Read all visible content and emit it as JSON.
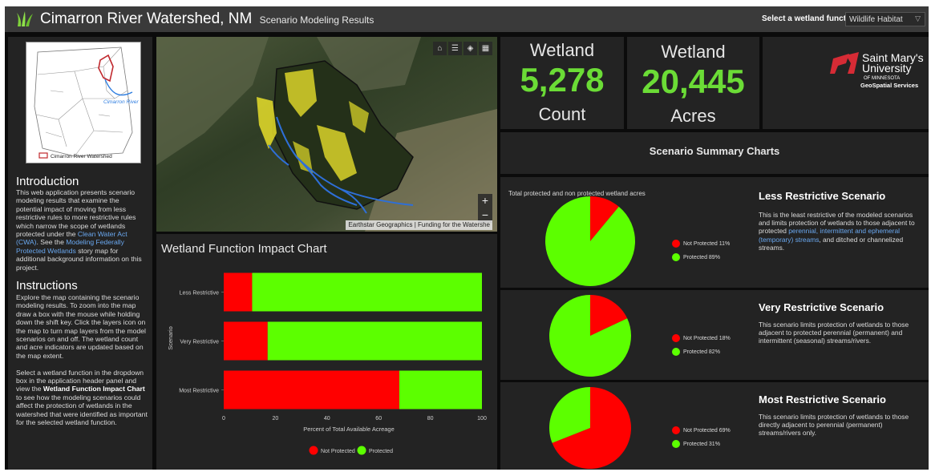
{
  "header": {
    "title": "Cimarron River Watershed, NM",
    "subtitle": "Scenario Modeling Results",
    "select_label": "Select a wetland function:",
    "select_value": "Wildlife Habitat",
    "logo_icon": "grass-icon"
  },
  "left": {
    "map_label_river": "Cimarron River",
    "map_legend": "Cimarron River Watershed",
    "intro_heading": "Introduction",
    "intro_text_1": "This web application presents scenario modeling results that examine the potential impact of moving from less restrictive rules to more restrictive rules which narrow the scope of wetlands protected under the ",
    "intro_link_1": "Clean Water Act (CWA)",
    "intro_text_2": ". See the ",
    "intro_link_2": "Modeling Federally Protected Wetlands",
    "intro_text_3": " story map for additional background information on this project.",
    "instr_heading": "Instructions",
    "instr_text_1": "Explore the map containing the scenario modeling results. To zoom into the map draw a box with the mouse while holding down the shift key. Click the layers icon on the map to turn map layers from the model scenarios on and off. The wetland count and acre indicators are updated based on the map extent.",
    "instr_text_2": "Select a wetland function in the dropdown box in the application header panel and view the ",
    "instr_bold": "Wetland Function Impact Chart",
    "instr_text_3": " to see how the modeling scenarios could affect the protection of wetlands in the watershed that were identified as important for the selected wetland function."
  },
  "map": {
    "attribution": "Earthstar Geographics | Funding for the Watershe",
    "tools": [
      "home-icon",
      "list-icon",
      "layers-icon",
      "grid-icon"
    ],
    "zoom_in": "+",
    "zoom_out": "−"
  },
  "indicators": {
    "count_label": "Wetland",
    "count_value": "5,278",
    "count_unit": "Count",
    "acres_label": "Wetland",
    "acres_value": "20,445",
    "acres_unit": "Acres"
  },
  "logo": {
    "line1": "Saint Mary's",
    "line2": "University",
    "line3": "OF MINNESOTA",
    "line4": "GeoSpatial Services"
  },
  "summary_title": "Scenario Summary Charts",
  "pie_chart_title": "Total protected and non protected wetland acres",
  "scenarios": [
    {
      "heading": "Less Restrictive Scenario",
      "text_1": "This is the least restrictive of the modeled scenarios and limits protection of wetlands to those adjacent to protected ",
      "link": "perennial, intermittent and ephemeral (temporary) streams",
      "text_2": ", and ditched or channelized streams.",
      "legend_not": "Not Protected  11%",
      "legend_yes": "Protected  89%"
    },
    {
      "heading": "Very Restrictive Scenario",
      "text_1": "This scenario limits protection of wetlands to those adjacent to protected perennial (permanent) and intermittent (seasonal) streams/rivers.",
      "link": "",
      "text_2": "",
      "legend_not": "Not Protected  18%",
      "legend_yes": "Protected  82%"
    },
    {
      "heading": "Most Restrictive Scenario",
      "text_1": "This scenario limits protection of wetlands to those directly adjacent to perennial (permanent) streams/rivers only.",
      "link": "",
      "text_2": "",
      "legend_not": "Not Protected  69%",
      "legend_yes": "Protected  31%"
    }
  ],
  "colors": {
    "not_protected": "#ff0000",
    "protected": "#5cff00",
    "indicator": "#6bdc36"
  },
  "chart_data": [
    {
      "type": "bar",
      "orientation": "horizontal",
      "stacked": true,
      "title": "Wetland Function Impact Chart",
      "xlabel": "Percent of Total Available Acreage",
      "ylabel": "Scenario",
      "categories": [
        "Less Restrictive",
        "Very Restrictive",
        "Most Restrictive"
      ],
      "series": [
        {
          "name": "Not Protected",
          "values": [
            11,
            17,
            68
          ]
        },
        {
          "name": "Protected",
          "values": [
            89,
            83,
            32
          ]
        }
      ],
      "xlim": [
        0,
        100
      ],
      "xticks": [
        "0",
        "20",
        "40",
        "60",
        "80",
        "100"
      ],
      "legend": "bottom"
    },
    {
      "type": "pie",
      "title": "Total protected and non protected wetland acres",
      "categories": [
        "Not Protected",
        "Protected"
      ],
      "values": [
        11,
        89
      ]
    },
    {
      "type": "pie",
      "categories": [
        "Not Protected",
        "Protected"
      ],
      "values": [
        18,
        82
      ]
    },
    {
      "type": "pie",
      "categories": [
        "Not Protected",
        "Protected"
      ],
      "values": [
        69,
        31
      ]
    }
  ]
}
